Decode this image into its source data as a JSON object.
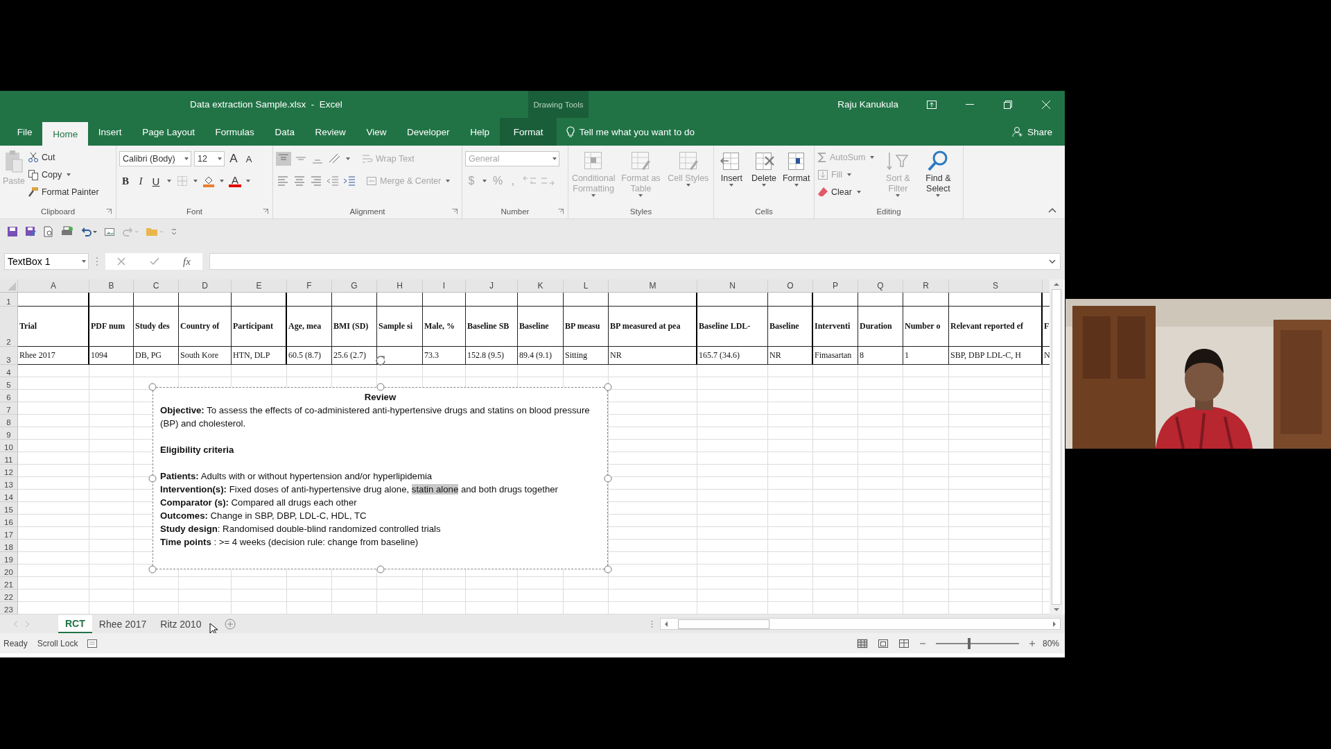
{
  "window": {
    "title": "Data extraction Sample.xlsx  -  Excel",
    "context_group": "Drawing Tools",
    "user": "Raju Kanukula"
  },
  "tabs": [
    {
      "label": "File",
      "selected": false,
      "kind": "normal"
    },
    {
      "label": "Home",
      "selected": true,
      "kind": "normal"
    },
    {
      "label": "Insert",
      "selected": false,
      "kind": "normal"
    },
    {
      "label": "Page Layout",
      "selected": false,
      "kind": "normal"
    },
    {
      "label": "Formulas",
      "selected": false,
      "kind": "normal"
    },
    {
      "label": "Data",
      "selected": false,
      "kind": "normal"
    },
    {
      "label": "Review",
      "selected": false,
      "kind": "normal"
    },
    {
      "label": "View",
      "selected": false,
      "kind": "normal"
    },
    {
      "label": "Developer",
      "selected": false,
      "kind": "normal"
    },
    {
      "label": "Help",
      "selected": false,
      "kind": "normal"
    },
    {
      "label": "Format",
      "selected": false,
      "kind": "contextual"
    }
  ],
  "tell_me": "Tell me what you want to do",
  "share": "Share",
  "ribbon": {
    "clipboard": {
      "label": "Clipboard",
      "paste": {
        "label": "Paste",
        "disabled": true
      },
      "cut": {
        "label": "Cut",
        "disabled": false
      },
      "copy": {
        "label": "Copy",
        "disabled": false
      },
      "format_painter": {
        "label": "Format Painter",
        "disabled": false
      }
    },
    "font": {
      "label": "Font",
      "family": "Calibri (Body)",
      "size": "12",
      "grow": "A",
      "shrink": "A",
      "bold": "B",
      "italic": "I",
      "underline": "U",
      "font_color": "A"
    },
    "alignment": {
      "label": "Alignment",
      "wrap_text": {
        "label": "Wrap Text",
        "disabled": true
      },
      "merge_center": {
        "label": "Merge & Center",
        "disabled": true
      }
    },
    "number": {
      "label": "Number",
      "disabled": true,
      "format": "General",
      "currency": "$",
      "percent": "%",
      "comma": ","
    },
    "styles": {
      "label": "Styles",
      "buttons": [
        {
          "label": "Conditional Formatting",
          "disabled": true
        },
        {
          "label": "Format as Table",
          "disabled": true
        },
        {
          "label": "Cell Styles",
          "disabled": true
        }
      ]
    },
    "cells": {
      "label": "Cells",
      "buttons": [
        {
          "label": "Insert",
          "disabled": false
        },
        {
          "label": "Delete",
          "disabled": false
        },
        {
          "label": "Format",
          "disabled": false
        }
      ]
    },
    "editing": {
      "label": "Editing",
      "autosum": {
        "label": "AutoSum",
        "disabled": true
      },
      "fill": {
        "label": "Fill",
        "disabled": true
      },
      "clear": {
        "label": "Clear",
        "disabled": false
      },
      "sort_filter": {
        "label": "Sort & Filter",
        "disabled": true
      },
      "find_select": {
        "label": "Find & Select",
        "disabled": false
      }
    }
  },
  "formula_bar": {
    "name_box": "TextBox 1",
    "function_symbol": "fx"
  },
  "sheet": {
    "columns": [
      "A",
      "B",
      "C",
      "D",
      "E",
      "F",
      "G",
      "H",
      "I",
      "J",
      "K",
      "L",
      "M",
      "N",
      "O",
      "P",
      "Q",
      "R",
      "S"
    ],
    "rows": [
      {
        "number": "1",
        "kind": "table"
      },
      {
        "number": "2",
        "kind": "header",
        "cells": [
          "Trial",
          "PDF num",
          "Study des",
          "Country of",
          "Participant",
          "Age, mea",
          "BMI (SD)",
          "Sample si",
          "Male, %",
          "Baseline SB",
          "Baseline",
          "BP measu",
          "BP measured at pea",
          "Baseline LDL-",
          "Baseline",
          "Interventi",
          "Duration",
          "Number o",
          "Relevant reported ef",
          "F"
        ]
      },
      {
        "number": "3",
        "kind": "table",
        "cells": [
          "Rhee 2017",
          "1094",
          "DB, PG",
          "South Kore",
          "HTN, DLP",
          "60.5 (8.7)",
          "25.6 (2.7)",
          null,
          "73.3",
          "152.8 (9.5)",
          "89.4 (9.1)",
          "Sitting",
          "NR",
          "165.7 (34.6)",
          "NR",
          "Fimasartan",
          "8",
          "1",
          "SBP, DBP LDL-C, H",
          "N"
        ]
      },
      {
        "number": "4",
        "kind": "blank"
      },
      {
        "number": "5",
        "kind": "blank"
      },
      {
        "number": "6",
        "kind": "blank"
      },
      {
        "number": "7",
        "kind": "blank"
      },
      {
        "number": "8",
        "kind": "blank"
      },
      {
        "number": "9",
        "kind": "blank"
      },
      {
        "number": "10",
        "kind": "blank"
      },
      {
        "number": "11",
        "kind": "blank"
      },
      {
        "number": "12",
        "kind": "blank"
      },
      {
        "number": "13",
        "kind": "blank"
      },
      {
        "number": "14",
        "kind": "blank"
      },
      {
        "number": "15",
        "kind": "blank"
      },
      {
        "number": "16",
        "kind": "blank"
      },
      {
        "number": "17",
        "kind": "blank"
      },
      {
        "number": "18",
        "kind": "blank"
      },
      {
        "number": "19",
        "kind": "blank"
      },
      {
        "number": "20",
        "kind": "blank"
      },
      {
        "number": "21",
        "kind": "blank"
      },
      {
        "number": "22",
        "kind": "blank"
      },
      {
        "number": "23",
        "kind": "blank"
      }
    ]
  },
  "textbox": {
    "title": "Review",
    "sections": [
      {
        "lines": [
          {
            "segments": [
              {
                "text": "**Objective:**  To assess the effects of co-administered anti-hypertensive drugs and statins on blood pressure (BP) and cholesterol.",
                "selected": false
              }
            ]
          }
        ]
      },
      {
        "lines": [
          {
            "segments": [
              {
                "text": "**Eligibility criteria**",
                "selected": false
              }
            ]
          }
        ]
      },
      {
        "lines": [
          {
            "segments": [
              {
                "text": "**Patients:** Adults with or without hypertension and/or hyperlipidemia",
                "selected": false
              }
            ]
          },
          {
            "segments": [
              {
                "text": "**Intervention(s):** Fixed doses of anti-hypertensive drug alone, ",
                "selected": false
              },
              {
                "text": "statin alone",
                "selected": true
              },
              {
                "text": " and both drugs together",
                "selected": false
              }
            ]
          },
          {
            "segments": [
              {
                "text": "**Comparator (s):**  Compared all drugs each other",
                "selected": false
              }
            ]
          },
          {
            "segments": [
              {
                "text": "**Outcomes:** Change in SBP, DBP, LDL-C, HDL, TC",
                "selected": false
              }
            ]
          },
          {
            "segments": [
              {
                "text": "**Study design**: Randomised double-blind randomized controlled trials",
                "selected": false
              }
            ]
          },
          {
            "segments": [
              {
                "text": "**Time points** : >= 4 weeks (decision rule: change from baseline)",
                "selected": false
              }
            ]
          }
        ]
      }
    ]
  },
  "sheet_tabs": [
    {
      "label": "RCT",
      "selected": true
    },
    {
      "label": "Rhee 2017",
      "selected": false
    },
    {
      "label": "Ritz 2010",
      "selected": false
    }
  ],
  "status_bar": {
    "ready": "Ready",
    "scroll_lock": "Scroll Lock",
    "zoom": {
      "level": 0.4,
      "reading": "80%"
    }
  }
}
